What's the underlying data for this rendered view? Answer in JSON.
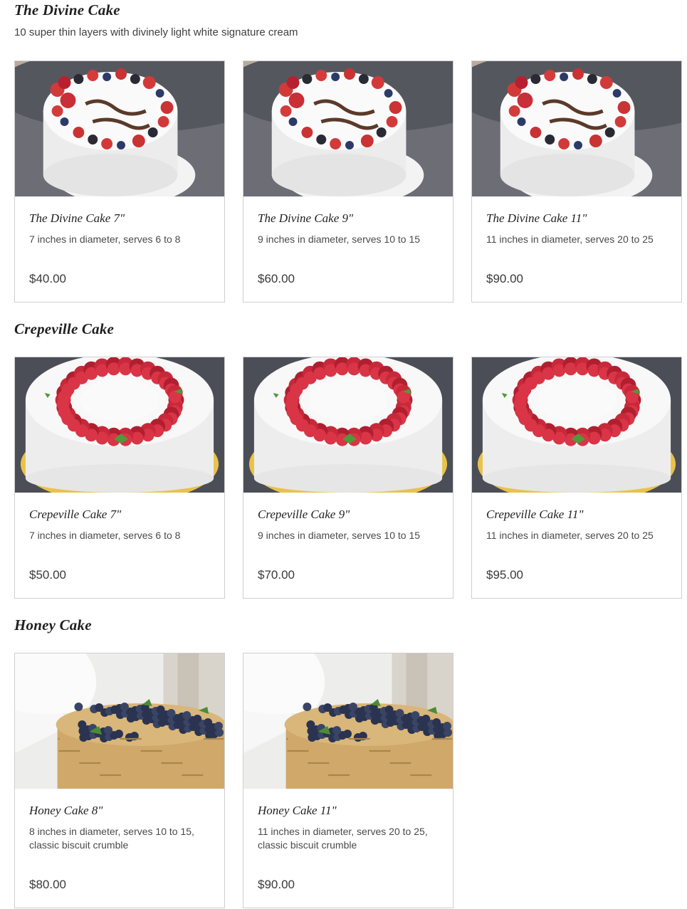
{
  "sections": [
    {
      "title": "The Divine Cake",
      "description": "10 super thin layers with divinely light white signature cream",
      "image_icon": "berry-birthday-cake-image",
      "items": [
        {
          "name": "The Divine Cake 7\"",
          "description": "7 inches in diameter, serves 6 to 8",
          "price": "$40.00"
        },
        {
          "name": "The Divine Cake 9\"",
          "description": "9 inches in diameter, serves 10 to 15",
          "price": "$60.00"
        },
        {
          "name": "The Divine Cake 11\"",
          "description": "11 inches in diameter, serves 20 to 25",
          "price": "$90.00"
        }
      ]
    },
    {
      "title": "Crepeville Cake",
      "description": "",
      "image_icon": "raspberry-wreath-cake-image",
      "items": [
        {
          "name": "Crepeville Cake 7\"",
          "description": "7 inches in diameter, serves 6 to 8",
          "price": "$50.00"
        },
        {
          "name": "Crepeville Cake 9\"",
          "description": "9 inches in diameter, serves 10 to 15",
          "price": "$70.00"
        },
        {
          "name": "Crepeville Cake 11\"",
          "description": "11 inches in diameter, serves 20 to 25",
          "price": "$95.00"
        }
      ]
    },
    {
      "title": "Honey Cake",
      "description": "",
      "image_icon": "blueberry-honey-cake-image",
      "items": [
        {
          "name": "Honey Cake 8\"",
          "description": "8 inches in diameter, serves 10 to 15, classic biscuit crumble",
          "price": "$80.00"
        },
        {
          "name": "Honey Cake 11\"",
          "description": "11 inches in diameter, serves 20 to 25, classic biscuit crumble",
          "price": "$90.00"
        }
      ]
    }
  ],
  "colors": {
    "border": "#cfcfcf",
    "text": "#3a3a3a",
    "heading": "#1f1f1f"
  }
}
